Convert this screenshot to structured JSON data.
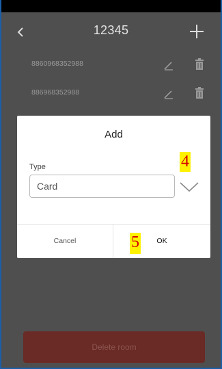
{
  "header": {
    "title": "12345"
  },
  "rows": [
    {
      "number": "8860968352988"
    },
    {
      "number": "886968352988"
    }
  ],
  "dialog": {
    "title": "Add",
    "type_label": "Type",
    "type_value": "Card",
    "cancel_label": "Cancel",
    "ok_label": "OK"
  },
  "footer": {
    "delete_label": "Delete room"
  },
  "annotations": {
    "marker_4": "4",
    "marker_5": "5"
  },
  "colors": {
    "background": "#4f4f4f",
    "delete_button": "#6a2a25",
    "marker_bg": "#fff200",
    "marker_text": "#d40000"
  }
}
